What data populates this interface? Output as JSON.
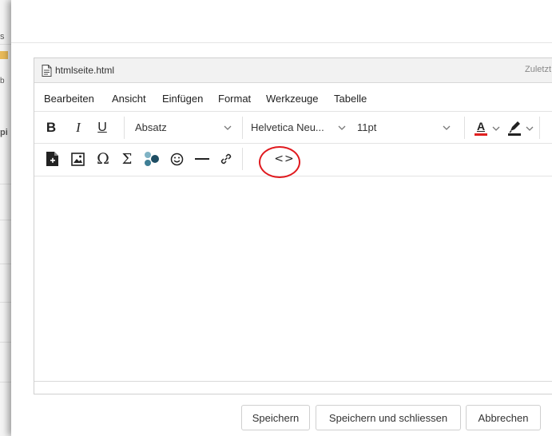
{
  "background": {
    "fragments": [
      "s",
      "b",
      "pi"
    ]
  },
  "editor": {
    "file_name": "htmlseite.html",
    "file_meta": "Zuletzt",
    "menu": [
      "Bearbeiten",
      "Ansicht",
      "Einfügen",
      "Format",
      "Werkzeuge",
      "Tabelle"
    ],
    "toolbar1": {
      "bold": "B",
      "italic": "I",
      "underline": "U",
      "block_format": "Absatz",
      "font_family": "Helvetica Neu...",
      "font_size": "11pt",
      "text_color": "A"
    },
    "toolbar2": {
      "omega": "Ω",
      "sigma": "Σ",
      "code": "<>"
    }
  },
  "footer": {
    "save_label": "Speichern",
    "save_close_label": "Speichern und schliessen",
    "cancel_label": "Abbrechen"
  },
  "colors": {
    "highlight": "#e0191e",
    "text_color_swatch": "#e02020",
    "highlight_color_swatch": "#222222"
  }
}
